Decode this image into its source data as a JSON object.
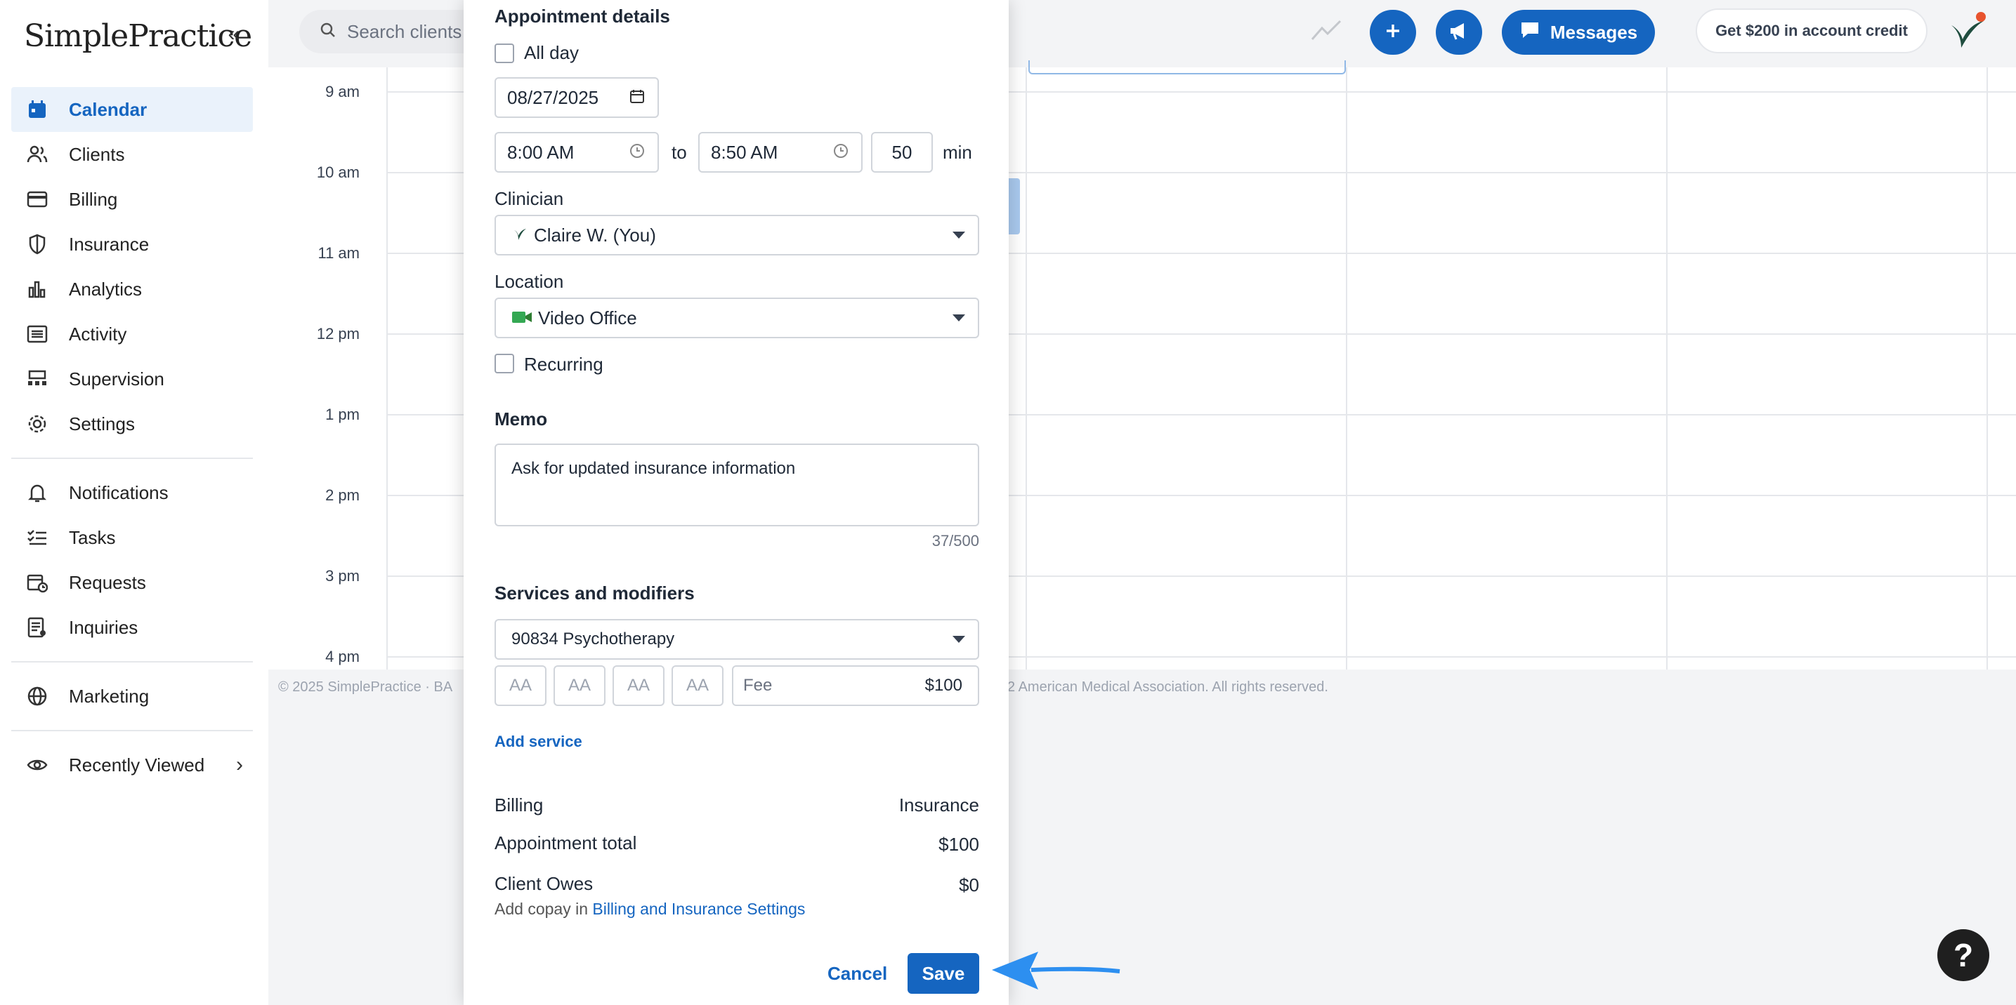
{
  "app": {
    "logo_text": "SimplePractice"
  },
  "sidebar": {
    "items": [
      {
        "label": "Calendar",
        "icon": "calendar-icon"
      },
      {
        "label": "Clients",
        "icon": "clients-icon"
      },
      {
        "label": "Billing",
        "icon": "billing-card-icon"
      },
      {
        "label": "Insurance",
        "icon": "shield-icon"
      },
      {
        "label": "Analytics",
        "icon": "bar-chart-icon"
      },
      {
        "label": "Activity",
        "icon": "activity-list-icon"
      },
      {
        "label": "Supervision",
        "icon": "supervision-icon"
      },
      {
        "label": "Settings",
        "icon": "gear-icon"
      },
      {
        "label": "Notifications",
        "icon": "bell-icon"
      },
      {
        "label": "Tasks",
        "icon": "tasks-icon"
      },
      {
        "label": "Requests",
        "icon": "requests-calendar-icon"
      },
      {
        "label": "Inquiries",
        "icon": "inquiries-icon"
      },
      {
        "label": "Marketing",
        "icon": "globe-icon"
      },
      {
        "label": "Recently Viewed",
        "icon": "eye-icon"
      }
    ]
  },
  "header": {
    "search_placeholder": "Search clients",
    "messages_label": "Messages",
    "credit_label": "Get $200 in account credit"
  },
  "calendar": {
    "times": [
      "9 am",
      "10 am",
      "11 am",
      "12 pm",
      "1 pm",
      "2 pm",
      "3 pm",
      "4 pm"
    ],
    "footer_left": "© 2025 SimplePractice · BA",
    "footer_right": "2 American Medical Association. All rights reserved."
  },
  "appointment": {
    "section_title": "Appointment details",
    "all_day_label": "All day",
    "date": "08/27/2025",
    "start_time": "8:00 AM",
    "to_label": "to",
    "end_time": "8:50 AM",
    "duration": "50",
    "duration_unit": "min",
    "clinician_label": "Clinician",
    "clinician_value": "Claire W. (You)",
    "location_label": "Location",
    "location_value": "Video Office",
    "recurring_label": "Recurring",
    "memo_label": "Memo",
    "memo_value": "Ask for updated insurance information",
    "memo_counter": "37/500",
    "services_label": "Services and modifiers",
    "service_value": "90834 Psychotherapy",
    "modifier_placeholder": "AA",
    "fee_label": "Fee",
    "fee_value": "$100",
    "add_service_label": "Add service",
    "billing_label": "Billing",
    "billing_value": "Insurance",
    "total_label": "Appointment total",
    "total_value": "$100",
    "owes_label": "Client Owes",
    "owes_value": "$0",
    "copay_text": "Add copay in",
    "copay_link": "Billing and Insurance Settings",
    "cancel_label": "Cancel",
    "save_label": "Save"
  },
  "help_label": "?",
  "colors": {
    "accent": "#1565c0",
    "active_bg": "#eaf2fb",
    "arrow": "#2d8ff0"
  }
}
